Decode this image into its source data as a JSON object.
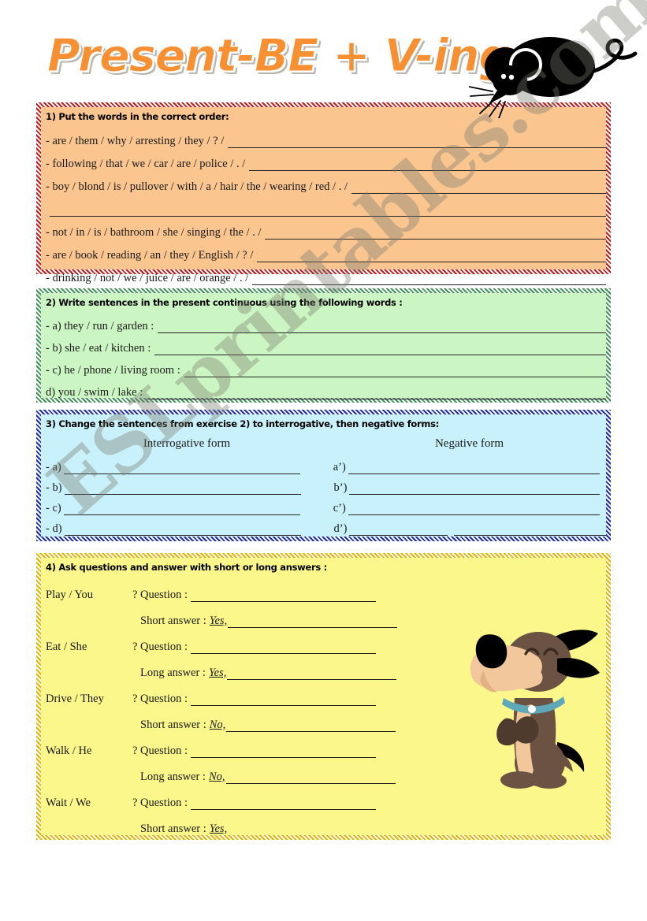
{
  "title": "Present-BE + V-ing",
  "watermark": "ESLprintables.com",
  "art": {
    "mouse": "mouse-illustration",
    "dog": "dog-illustration"
  },
  "section1": {
    "heading": "1) Put the words in the correct order:",
    "items": [
      "- are / them / why / arresting / they / ? /",
      "- following / that / we / car / are / police / . /",
      "- boy / blond / is / pullover / with / a / hair / the / wearing / red / . /",
      "",
      "- not / in / is / bathroom / she / singing / the / . /",
      "- are / book / reading / an / they /  English / ? /",
      "- drinking / not / we / juice / are / orange / . /"
    ]
  },
  "section2": {
    "heading": "2) Write sentences in the present continuous using the following words :",
    "items": [
      "- a)  they / run / garden :",
      "- b) she / eat / kitchen :",
      "- c) he / phone / living room :",
      " d) you / swim / lake :"
    ]
  },
  "section3": {
    "heading": "3) Change the sentences from exercise 2)  to interrogative, then negative forms:",
    "column_headers": [
      "Interrogative form",
      "Negative form"
    ],
    "rows": [
      {
        "left": "- a)",
        "right": "a’)"
      },
      {
        "left": "- b)",
        "right": "b’)"
      },
      {
        "left": "- c)",
        "right": "c’)"
      },
      {
        "left": "- d)",
        "right": "d’)"
      }
    ]
  },
  "section4": {
    "heading": "4) Ask questions and answer with short or long answers :",
    "question_label": "Question :",
    "blocks": [
      {
        "cue": "Play / You",
        "mark": "?",
        "answer_label": "Short answer :",
        "answer_prefill": "Yes,"
      },
      {
        "cue": "Eat / She",
        "mark": "?",
        "answer_label": "Long answer :",
        "answer_prefill": "Yes,"
      },
      {
        "cue": "Drive / They",
        "mark": "?",
        "answer_label": "Short answer :",
        "answer_prefill": "No,"
      },
      {
        "cue": "Walk / He",
        "mark": "?",
        "answer_label": "Long answer :",
        "answer_prefill": "No,"
      },
      {
        "cue": "Wait / We",
        "mark": "?",
        "answer_label": "Short answer :",
        "answer_prefill": "Yes,"
      }
    ]
  },
  "colors": {
    "title": "#F79033",
    "section1_fill": "#FBC590",
    "section1_border": "#C01A1A",
    "section2_fill": "#CBF5C2",
    "section2_border": "#3F9158",
    "section3_fill": "#C9F1FB",
    "section3_border": "#1C2FA8",
    "section4_fill": "#FBF78B",
    "section4_border": "#E0B400"
  }
}
